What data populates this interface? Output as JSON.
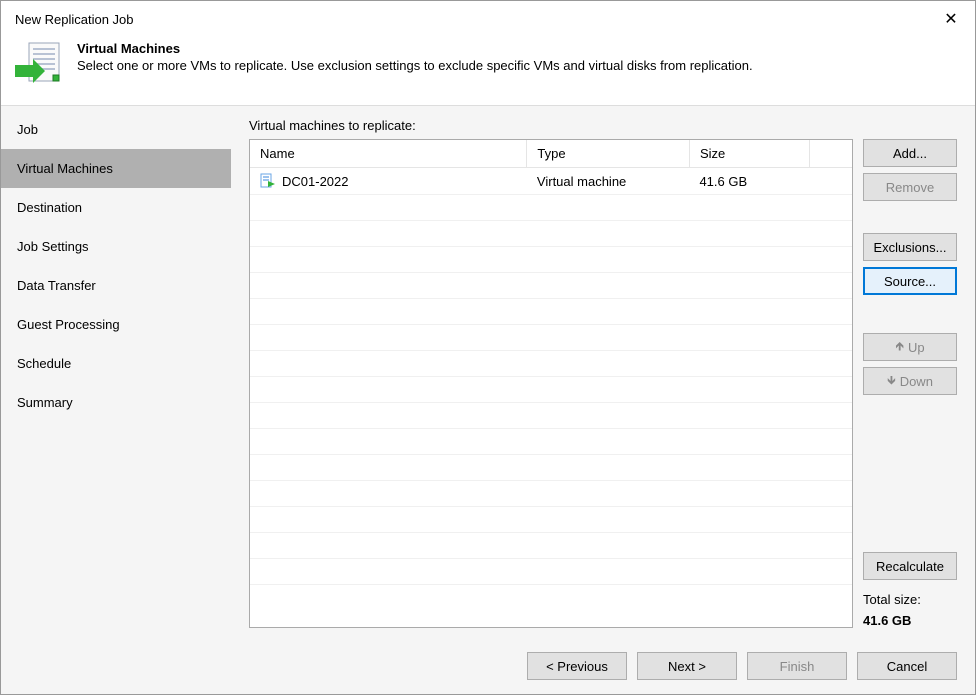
{
  "titlebar": {
    "title": "New Replication Job"
  },
  "header": {
    "title": "Virtual Machines",
    "subtitle": "Select one or more VMs to replicate. Use exclusion settings to exclude specific VMs and virtual disks from replication."
  },
  "sidebar": {
    "items": [
      {
        "label": "Job",
        "active": false
      },
      {
        "label": "Virtual Machines",
        "active": true
      },
      {
        "label": "Destination",
        "active": false
      },
      {
        "label": "Job Settings",
        "active": false
      },
      {
        "label": "Data Transfer",
        "active": false
      },
      {
        "label": "Guest Processing",
        "active": false
      },
      {
        "label": "Schedule",
        "active": false
      },
      {
        "label": "Summary",
        "active": false
      }
    ]
  },
  "main": {
    "label": "Virtual machines to replicate:",
    "columns": {
      "name": "Name",
      "type": "Type",
      "size": "Size"
    },
    "rows": [
      {
        "name": "DC01-2022",
        "type": "Virtual machine",
        "size": "41.6 GB"
      }
    ],
    "buttons": {
      "add": "Add...",
      "remove": "Remove",
      "exclusions": "Exclusions...",
      "source": "Source...",
      "up": "Up",
      "down": "Down",
      "recalculate": "Recalculate"
    },
    "total_label": "Total size:",
    "total_value": "41.6 GB"
  },
  "footer": {
    "previous": "< Previous",
    "next": "Next >",
    "finish": "Finish",
    "cancel": "Cancel"
  }
}
